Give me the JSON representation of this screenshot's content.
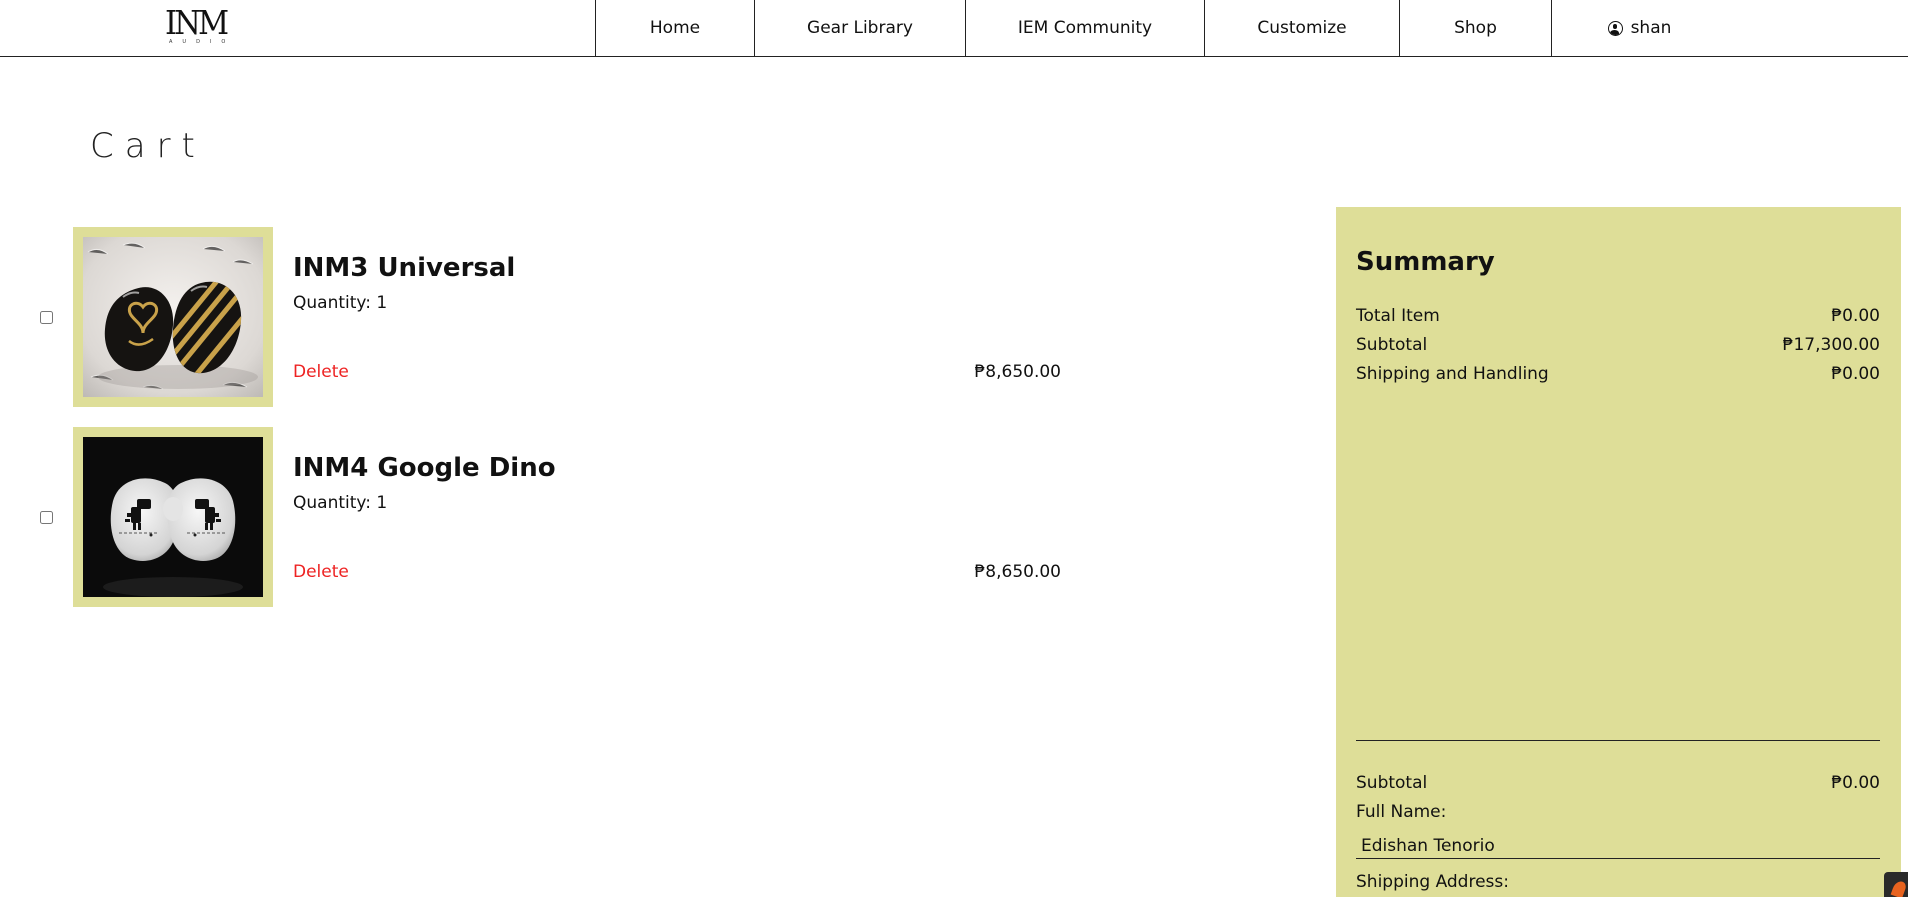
{
  "brand": {
    "logo_text": "INM",
    "logo_subtext": "AUDIO"
  },
  "nav": {
    "items": [
      {
        "label": "Home"
      },
      {
        "label": "Gear Library"
      },
      {
        "label": "IEM Community"
      },
      {
        "label": "Customize"
      },
      {
        "label": "Shop"
      }
    ],
    "user": {
      "icon": "user-circle-icon",
      "label": "shan"
    }
  },
  "page": {
    "title": "Cart"
  },
  "cart": {
    "items": [
      {
        "name": "INM3 Universal",
        "quantity": "Quantity: 1",
        "delete_label": "Delete",
        "price": "₱8,650.00",
        "checked": false,
        "image": "black-gold-iem-photo"
      },
      {
        "name": "INM4 Google Dino",
        "quantity": "Quantity: 1",
        "delete_label": "Delete",
        "price": "₱8,650.00",
        "checked": false,
        "image": "white-dino-iem-photo"
      }
    ]
  },
  "summary": {
    "title": "Summary",
    "rows": [
      {
        "label": "Total Item",
        "value": "₱0.00"
      },
      {
        "label": "Subtotal",
        "value": "₱17,300.00"
      },
      {
        "label": "Shipping and Handling",
        "value": "₱0.00"
      }
    ],
    "footer_subtotal": {
      "label": "Subtotal",
      "value": "₱0.00"
    },
    "full_name_label": "Full Name:",
    "full_name_value": "Edishan Tenorio",
    "shipping_address_label": "Shipping Address:"
  },
  "colors": {
    "accent": "#dede98",
    "delete": "#ee2222",
    "text": "#111111"
  }
}
